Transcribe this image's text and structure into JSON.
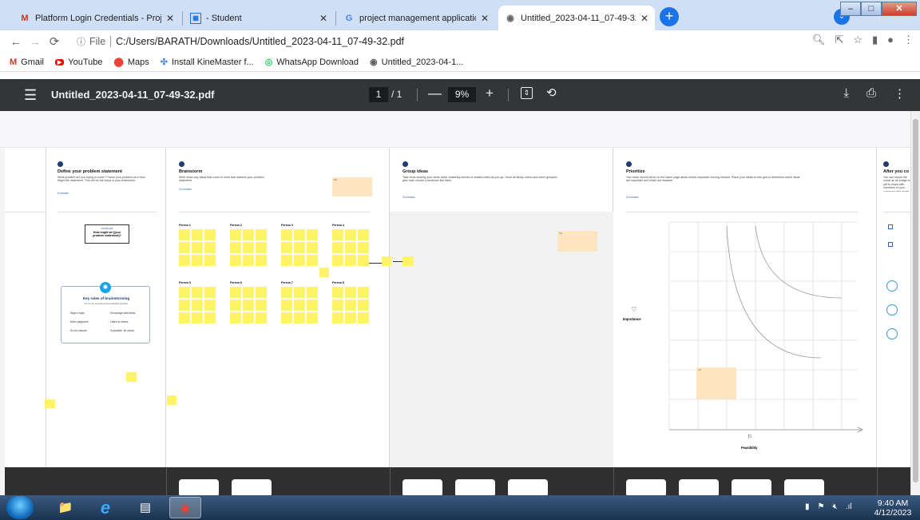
{
  "tabs": [
    {
      "title": "Platform Login Credentials - Proj",
      "icon": "gmail-icon"
    },
    {
      "title": "- Student",
      "icon": "sheet-icon"
    },
    {
      "title": "project management application",
      "icon": "google-icon"
    },
    {
      "title": "Untitled_2023-04-11_07-49-32.p",
      "icon": "globe-icon"
    }
  ],
  "address": {
    "scheme": "File",
    "url": "C:/Users/BARATH/Downloads/Untitled_2023-04-11_07-49-32.pdf"
  },
  "bookmarks": [
    {
      "label": "Gmail"
    },
    {
      "label": "YouTube"
    },
    {
      "label": "Maps"
    },
    {
      "label": "Install KineMaster f..."
    },
    {
      "label": "WhatsApp Download"
    },
    {
      "label": "Untitled_2023-04-1..."
    }
  ],
  "pdf": {
    "title": "Untitled_2023-04-11_07-49-32.pdf",
    "page_current": "1",
    "page_total": "/ 1",
    "zoom": "9%"
  },
  "sections": [
    {
      "num": "1",
      "title": "Define your problem statement",
      "desc": "What problem are you trying to solve? Frame your problem as a How Might We statement. This will be the focus of your brainstorm.",
      "time": "5 minutes"
    },
    {
      "num": "2",
      "title": "Brainstorm",
      "desc": "Write down any ideas that come to mind that address your problem statement.",
      "time": "10 minutes"
    },
    {
      "num": "3",
      "title": "Group ideas",
      "desc": "Take turns sharing your ideas while clustering similar or related notes as you go. Once all sticky notes have been grouped, give each cluster a sentence-like label.",
      "time": "20 minutes"
    },
    {
      "num": "4",
      "title": "Prioritize",
      "desc": "Your team should all be on the same page about what's important moving forward. Place your ideas on this grid to determine which ideas are important and which are feasible.",
      "time": "20 minutes"
    },
    {
      "num": "5",
      "title": "After you co",
      "desc": "You can export the mural as an image or pdf to share with members of your company who might find it helpful.",
      "time": ""
    }
  ],
  "brainstorm": {
    "persons": [
      "Person 1",
      "Person 2",
      "Person 3",
      "Person 4",
      "Person 5",
      "Person 6",
      "Person 7",
      "Person 8"
    ]
  },
  "problem_box": {
    "label": "PROBLEM",
    "text": "How might we [your problem statement]?"
  },
  "key_rules": {
    "title": "Key rules of brainstorming",
    "subtitle": "To run an smooth and productive session",
    "rules": [
      "Stay in topic",
      "Encourage wild ideas",
      "Defer judgment",
      "Listen to others",
      "Go for volume",
      "If possible, be visual"
    ]
  },
  "prioritize": {
    "y_label": "Importance",
    "x_label": "Feasibility"
  },
  "taskbar": {
    "time": "9:40 AM",
    "date": "4/12/2023"
  }
}
